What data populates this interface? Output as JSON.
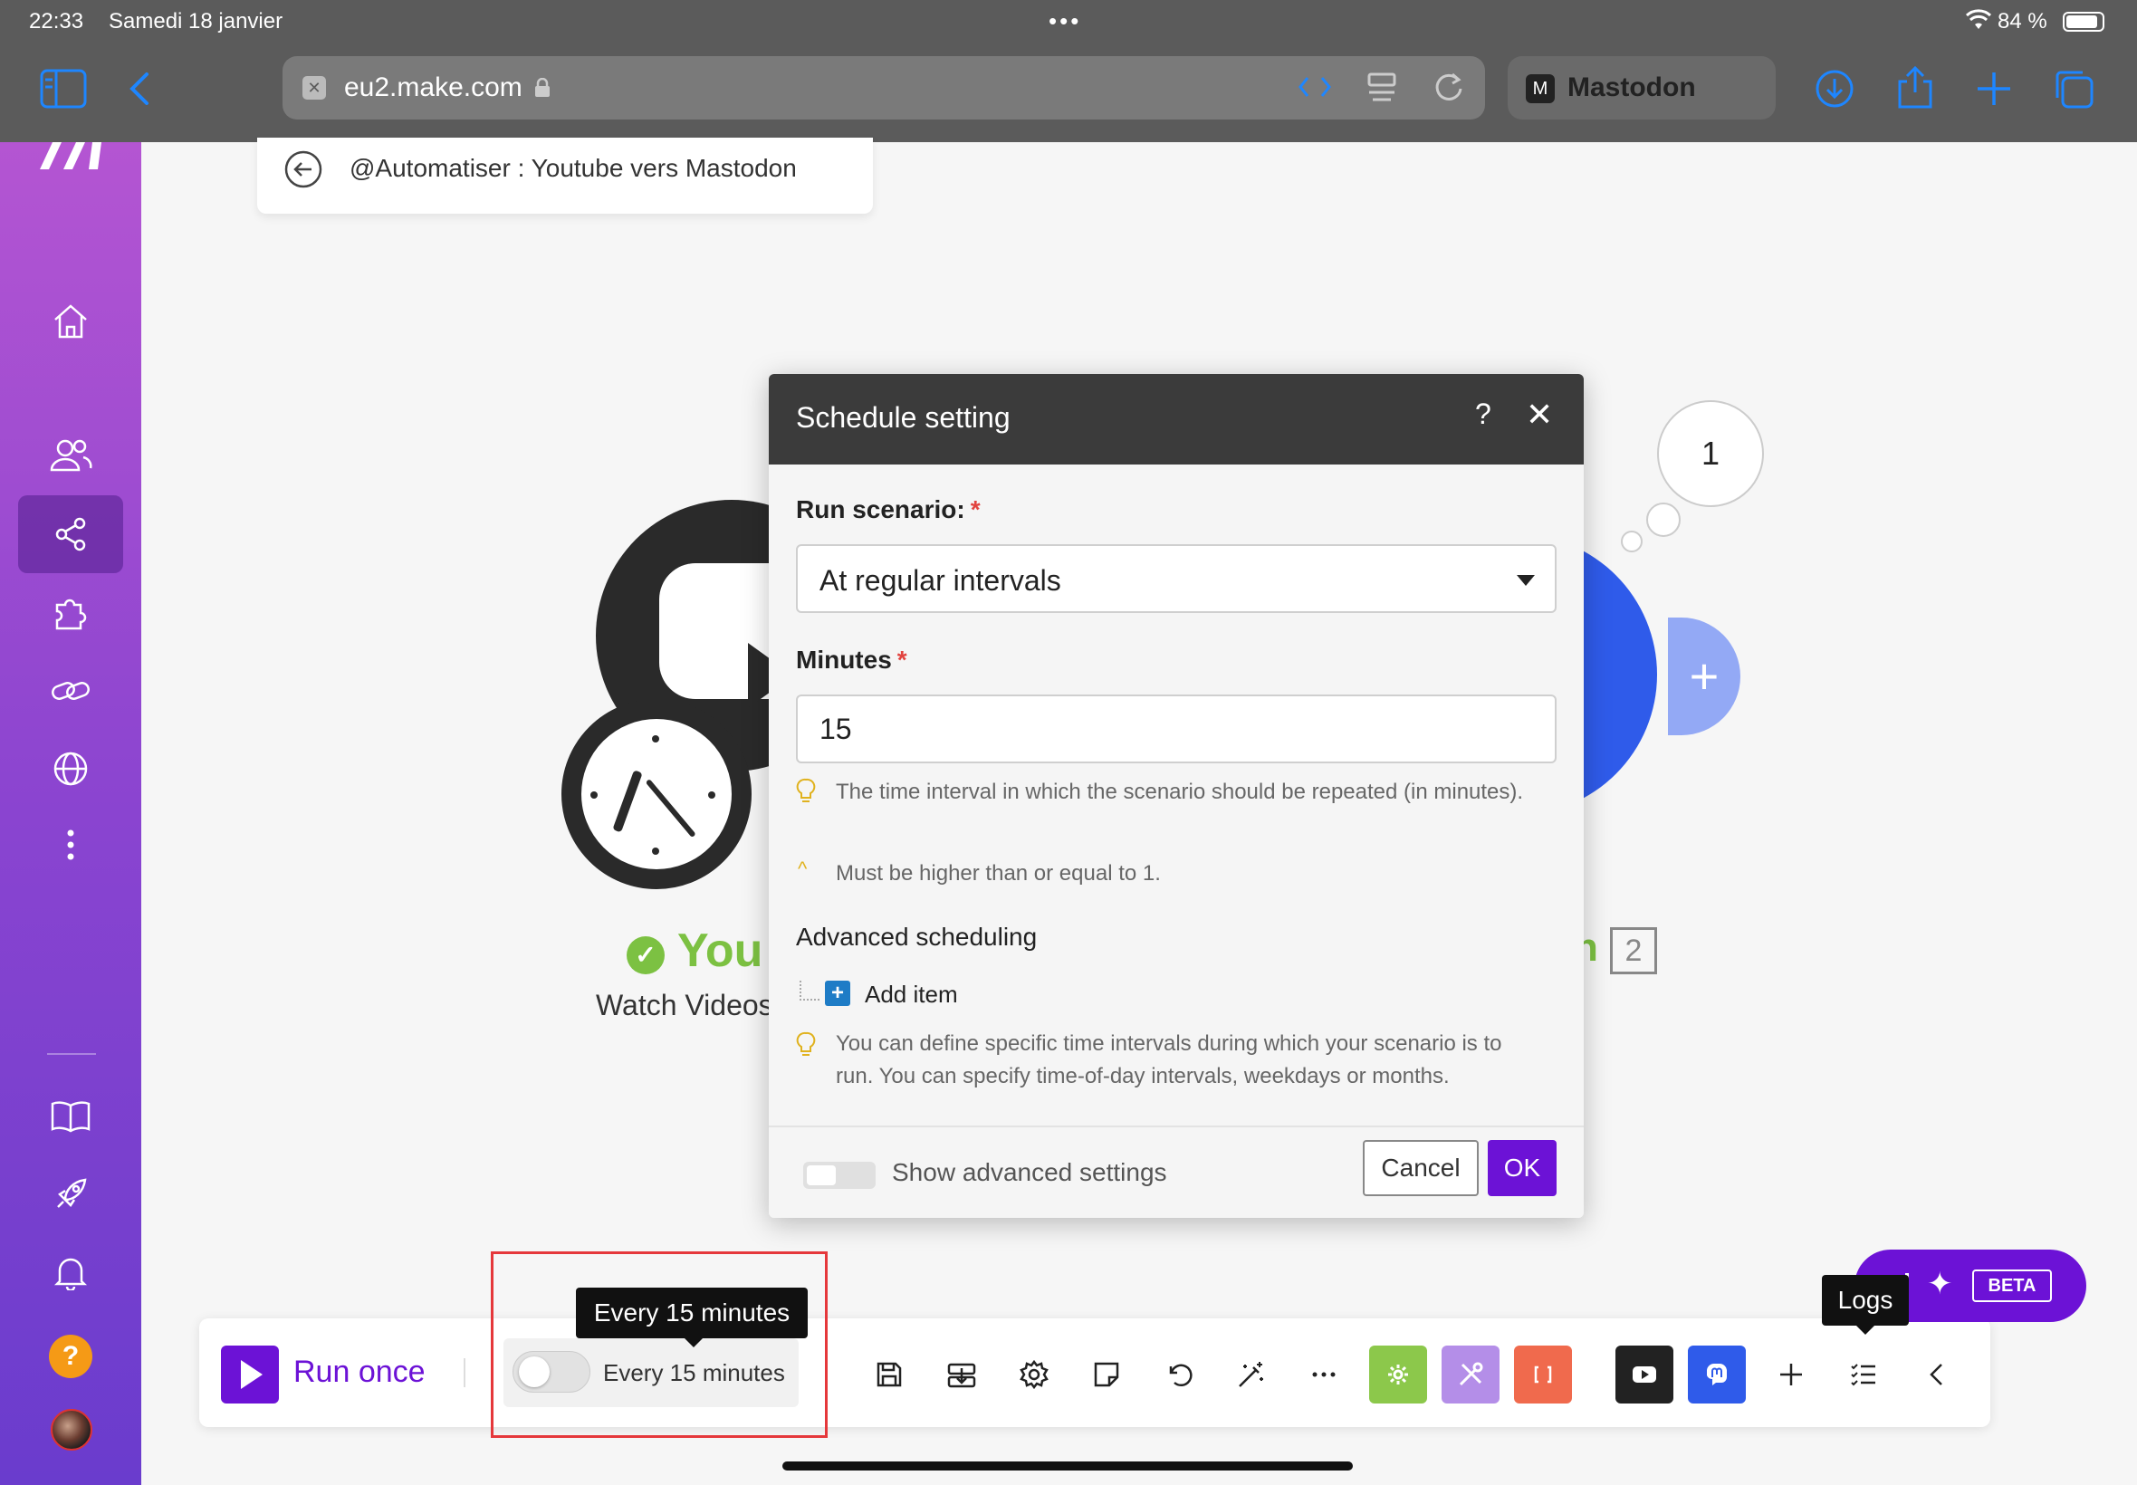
{
  "status_bar": {
    "time": "22:33",
    "date": "Samedi 18 janvier",
    "battery": "84 %"
  },
  "browser": {
    "url": "eu2.make.com",
    "tab_title": "Mastodon",
    "tab_icon_letter": "M",
    "accent_color": "#1e86ff"
  },
  "sidebar": {
    "active_item": "scenarios",
    "help_label": "?",
    "gradient_colors": [
      "#b455d2",
      "#6a3ccd"
    ]
  },
  "breadcrumb": {
    "title": "@Automatiser : Youtube vers Mastodon"
  },
  "canvas": {
    "module1": {
      "name": "You",
      "subtitle": "Watch Videos",
      "status_color": "#7cc142"
    },
    "module2": {
      "name_fragment": "n",
      "index": "2",
      "bubble_count": "1",
      "color": "#2f5bea"
    }
  },
  "dialog": {
    "title": "Schedule setting",
    "help": "?",
    "close": "✕",
    "run_scenario_label": "Run scenario:",
    "required_mark": "*",
    "run_scenario_value": "At regular intervals",
    "minutes_label": "Minutes",
    "minutes_value": "15",
    "minutes_hint": "The time interval in which the scenario should be repeated (in minutes).",
    "minutes_validation": "Must be higher than or equal to 1.",
    "advanced_title": "Advanced scheduling",
    "add_item": "Add item",
    "advanced_hint": "You can define specific time intervals during which your scenario is to run. You can specify time-of-day intervals, weekdays or months.",
    "show_advanced": "Show advanced settings",
    "cancel": "Cancel",
    "ok": "OK",
    "accent_color": "#6c12d6"
  },
  "toolbar": {
    "run_once": "Run once",
    "schedule_label": "Every 15 minutes",
    "schedule_tooltip": "Every 15 minutes",
    "logs_tooltip": "Logs",
    "ai_badge": "BETA",
    "module_colors": [
      "#8cc84b",
      "#b48ee8",
      "#f06a4d",
      "#222222",
      "#2f5bea"
    ]
  }
}
